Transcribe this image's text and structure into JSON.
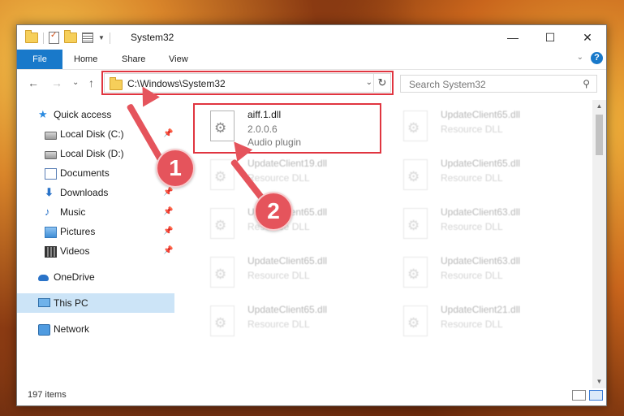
{
  "window": {
    "title": "System32",
    "controls": {
      "minimize": "—",
      "maximize": "☐",
      "close": "✕"
    }
  },
  "ribbon": {
    "tabs": [
      "File",
      "Home",
      "Share",
      "View"
    ],
    "expand_glyph": "⌄",
    "help_glyph": "?"
  },
  "navigation": {
    "back": "←",
    "forward": "→",
    "recent": "⌄",
    "up": "↑",
    "address": "C:\\Windows\\System32",
    "address_dropdown": "⌄",
    "refresh": "↻",
    "search_placeholder": "Search System32",
    "search_glyph": "⚲"
  },
  "sidebar": {
    "items": [
      {
        "label": "Quick access",
        "icon": "star-icon"
      },
      {
        "label": "Local Disk (C:)",
        "icon": "drive-icon",
        "pinned": true
      },
      {
        "label": "Local Disk (D:)",
        "icon": "drive-icon"
      },
      {
        "label": "Documents",
        "icon": "documents-icon"
      },
      {
        "label": "Downloads",
        "icon": "download-icon",
        "pinned": true
      },
      {
        "label": "Music",
        "icon": "music-icon",
        "pinned": true
      },
      {
        "label": "Pictures",
        "icon": "pictures-icon",
        "pinned": true
      },
      {
        "label": "Videos",
        "icon": "videos-icon",
        "pinned": true
      },
      {
        "label": "OneDrive",
        "icon": "onedrive-icon"
      },
      {
        "label": "This PC",
        "icon": "pc-icon",
        "selected": true
      },
      {
        "label": "Network",
        "icon": "network-icon"
      }
    ],
    "pin_glyph": "📌"
  },
  "files": {
    "highlighted": {
      "name": "aiff.1.dll",
      "version": "2.0.0.6",
      "description": "Audio plugin"
    },
    "column_left": [
      {
        "name": "UpdateClient19.dll",
        "description": "Resource DLL"
      },
      {
        "name": "UpdateClient65.dll",
        "description": "Resource DLL"
      },
      {
        "name": "UpdateClient65.dll",
        "description": "Resource DLL"
      },
      {
        "name": "UpdateClient65.dll",
        "description": "Resource DLL"
      }
    ],
    "column_right": [
      {
        "name": "UpdateClient65.dll",
        "description": "Resource DLL"
      },
      {
        "name": "UpdateClient65.dll",
        "description": "Resource DLL"
      },
      {
        "name": "UpdateClient63.dll",
        "description": "Resource DLL"
      },
      {
        "name": "UpdateClient63.dll",
        "description": "Resource DLL"
      },
      {
        "name": "UpdateClient21.dll",
        "description": "Resource DLL"
      }
    ]
  },
  "status": {
    "item_count": "197 items"
  },
  "callouts": {
    "one": "1",
    "two": "2",
    "color": "#e5545c"
  },
  "scroll": {
    "up": "▲",
    "down": "▼"
  }
}
